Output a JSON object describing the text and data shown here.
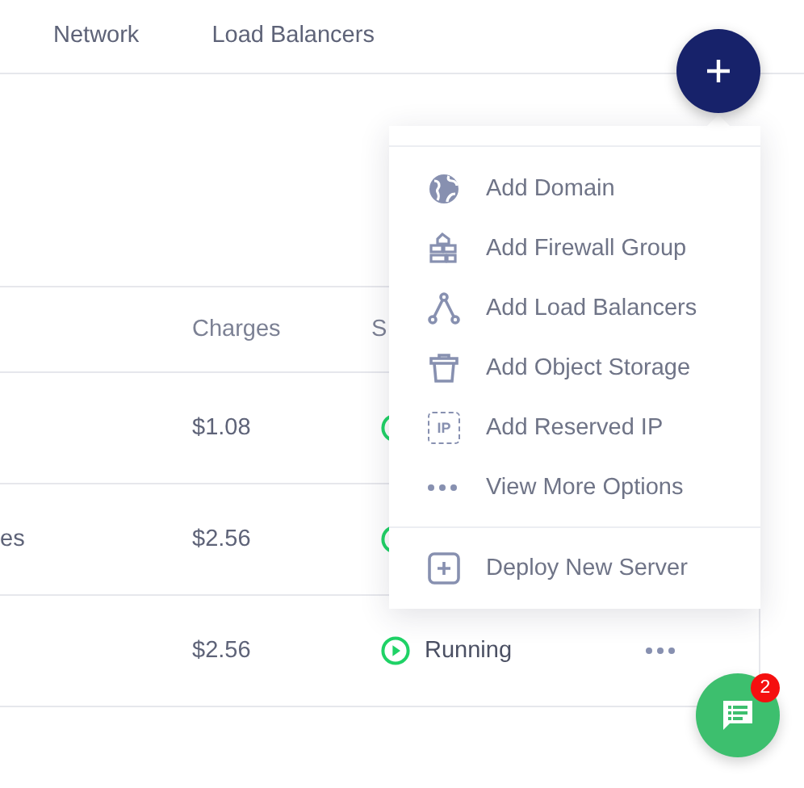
{
  "tabs": [
    {
      "label": "Network",
      "selected": false
    },
    {
      "label": "Load Balancers",
      "selected": false
    }
  ],
  "table": {
    "columns": [
      "Charges",
      "S"
    ],
    "rows": [
      {
        "charges": "$1.08",
        "running": true
      },
      {
        "name": "es",
        "charges": "$2.56",
        "running": true
      },
      {
        "charges": "$2.56",
        "running": true,
        "status_label": "Running"
      }
    ]
  },
  "add_menu": {
    "open": true,
    "items": [
      {
        "kind": "globe",
        "label": "Add Domain"
      },
      {
        "kind": "firewall",
        "label": "Add Firewall Group"
      },
      {
        "kind": "branch",
        "label": "Add Load Balancers"
      },
      {
        "kind": "basket",
        "label": "Add Object Storage"
      },
      {
        "kind": "ip",
        "icon_text": "IP",
        "label": "Add Reserved IP"
      },
      {
        "kind": "more",
        "label": "View More Options"
      }
    ],
    "footer_item": {
      "kind": "plus",
      "label": "Deploy New Server"
    }
  },
  "chat": {
    "badge": "2"
  }
}
